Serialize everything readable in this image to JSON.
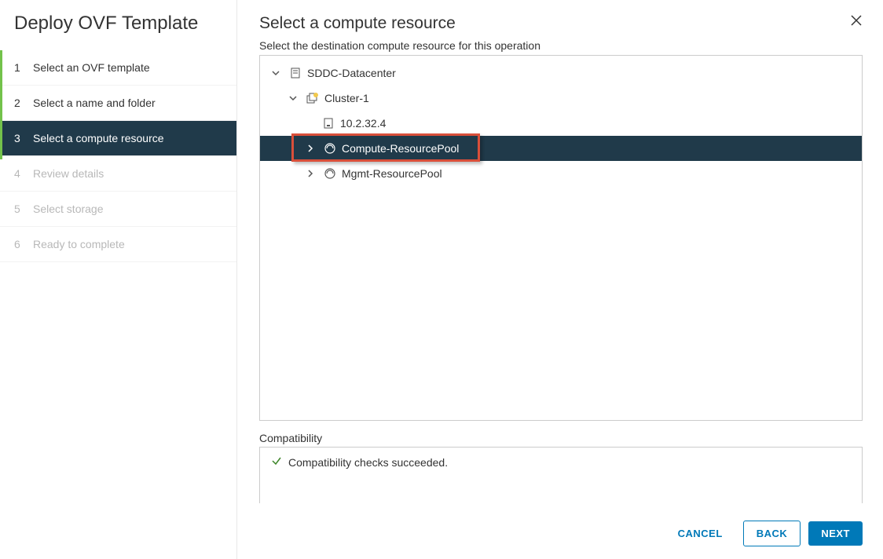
{
  "wizard": {
    "title": "Deploy OVF Template",
    "steps": [
      {
        "num": "1",
        "label": "Select an OVF template",
        "state": "done"
      },
      {
        "num": "2",
        "label": "Select a name and folder",
        "state": "done"
      },
      {
        "num": "3",
        "label": "Select a compute resource",
        "state": "active"
      },
      {
        "num": "4",
        "label": "Review details",
        "state": "disabled"
      },
      {
        "num": "5",
        "label": "Select storage",
        "state": "disabled"
      },
      {
        "num": "6",
        "label": "Ready to complete",
        "state": "disabled"
      }
    ]
  },
  "page": {
    "title": "Select a compute resource",
    "subtitle": "Select the destination compute resource for this operation"
  },
  "tree": {
    "datacenter": "SDDC-Datacenter",
    "cluster": "Cluster-1",
    "host": "10.2.32.4",
    "pool1": "Compute-ResourcePool",
    "pool2": "Mgmt-ResourcePool"
  },
  "compat": {
    "label": "Compatibility",
    "message": "Compatibility checks succeeded."
  },
  "buttons": {
    "cancel": "CANCEL",
    "back": "BACK",
    "next": "NEXT"
  }
}
